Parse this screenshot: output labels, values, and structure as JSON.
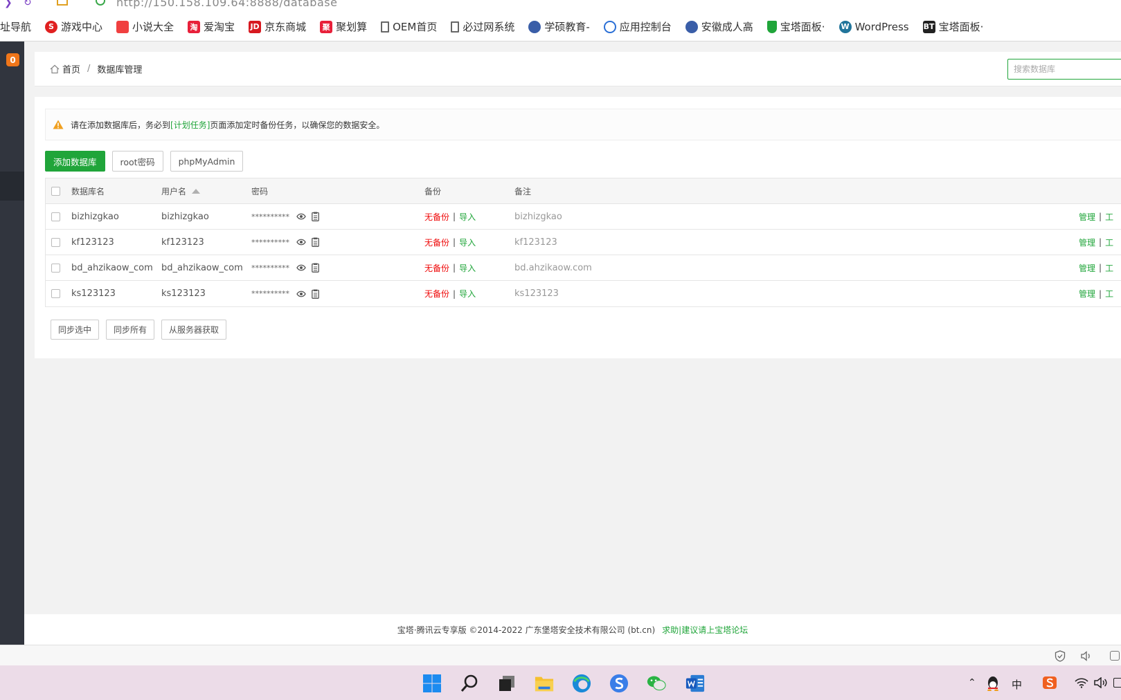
{
  "browser": {
    "url": "http://150.158.109.64:8888/database"
  },
  "bookmarks": [
    {
      "label": "址导航",
      "icon": "none"
    },
    {
      "label": "游戏中心",
      "icon": "game-icon",
      "color": "#e02020"
    },
    {
      "label": "小说大全",
      "icon": "novel-icon",
      "color": "#f04040"
    },
    {
      "label": "爱淘宝",
      "icon": "taobao-icon",
      "color": "#e8203a"
    },
    {
      "label": "京东商城",
      "icon": "jd-icon",
      "color": "#d71920"
    },
    {
      "label": "聚划算",
      "icon": "juhuasuan-icon",
      "color": "#e8203a"
    },
    {
      "label": "OEM首页",
      "icon": "page-icon",
      "color": "#666666"
    },
    {
      "label": "必过网系统",
      "icon": "page-icon",
      "color": "#666666"
    },
    {
      "label": "学硕教育-",
      "icon": "badge-icon",
      "color": "#3a5ea8"
    },
    {
      "label": "应用控制台",
      "icon": "cloud-icon",
      "color": "#2a6fd6"
    },
    {
      "label": "安徽成人高",
      "icon": "badge-icon",
      "color": "#3a5ea8"
    },
    {
      "label": "宝塔面板·",
      "icon": "bt-shield-icon",
      "color": "#20a53a"
    },
    {
      "label": "WordPress",
      "icon": "wordpress-icon",
      "color": "#21759b"
    },
    {
      "label": "宝塔面板·",
      "icon": "bt-icon",
      "color": "#222222"
    }
  ],
  "sidebar": {
    "badge": "0"
  },
  "breadcrumb": {
    "home": "首页",
    "separator": "/",
    "current": "数据库管理"
  },
  "search": {
    "placeholder": "搜索数据库"
  },
  "notice": {
    "prefix": "请在添加数据库后，务必到",
    "link": "[计划任务]",
    "suffix": "页面添加定时备份任务，以确保您的数据安全。"
  },
  "toolbar": {
    "add_label": "添加数据库",
    "root_label": "root密码",
    "pma_label": "phpMyAdmin"
  },
  "table": {
    "headers": {
      "name": "数据库名",
      "user": "用户名",
      "password": "密码",
      "backup": "备份",
      "note": "备注"
    },
    "rows": [
      {
        "name": "bizhizgkao",
        "user": "bizhizgkao",
        "password": "**********",
        "backup_status": "无备份",
        "import": "导入",
        "note": "bizhizgkao",
        "manage": "管理",
        "tools": "工"
      },
      {
        "name": "kf123123",
        "user": "kf123123",
        "password": "**********",
        "backup_status": "无备份",
        "import": "导入",
        "note": "kf123123",
        "manage": "管理",
        "tools": "工"
      },
      {
        "name": "bd_ahzikaow_com",
        "user": "bd_ahzikaow_com",
        "password": "**********",
        "backup_status": "无备份",
        "import": "导入",
        "note": "bd.ahzikaow.com",
        "manage": "管理",
        "tools": "工"
      },
      {
        "name": "ks123123",
        "user": "ks123123",
        "password": "**********",
        "backup_status": "无备份",
        "import": "导入",
        "note": "ks123123",
        "manage": "管理",
        "tools": "工"
      }
    ]
  },
  "bottom_buttons": {
    "sync_selected": "同步选中",
    "sync_all": "同步所有",
    "fetch_server": "从服务器获取"
  },
  "footer": {
    "copyright": "宝塔·腾讯云专享版 ©2014-2022 广东堡塔安全技术有限公司 (bt.cn)",
    "link": "求助|建议请上宝塔论坛"
  },
  "colors": {
    "accent": "#20a53a",
    "warning": "#f0a020",
    "danger": "#ef0808",
    "sidebar": "#31353e",
    "badge": "#f0761a"
  },
  "taskbar": {
    "ime": "中",
    "icons": [
      "start-icon",
      "search-icon",
      "taskview-icon",
      "file-explorer-icon",
      "edge-icon",
      "sogou-icon",
      "wechat-icon",
      "word-icon"
    ]
  }
}
